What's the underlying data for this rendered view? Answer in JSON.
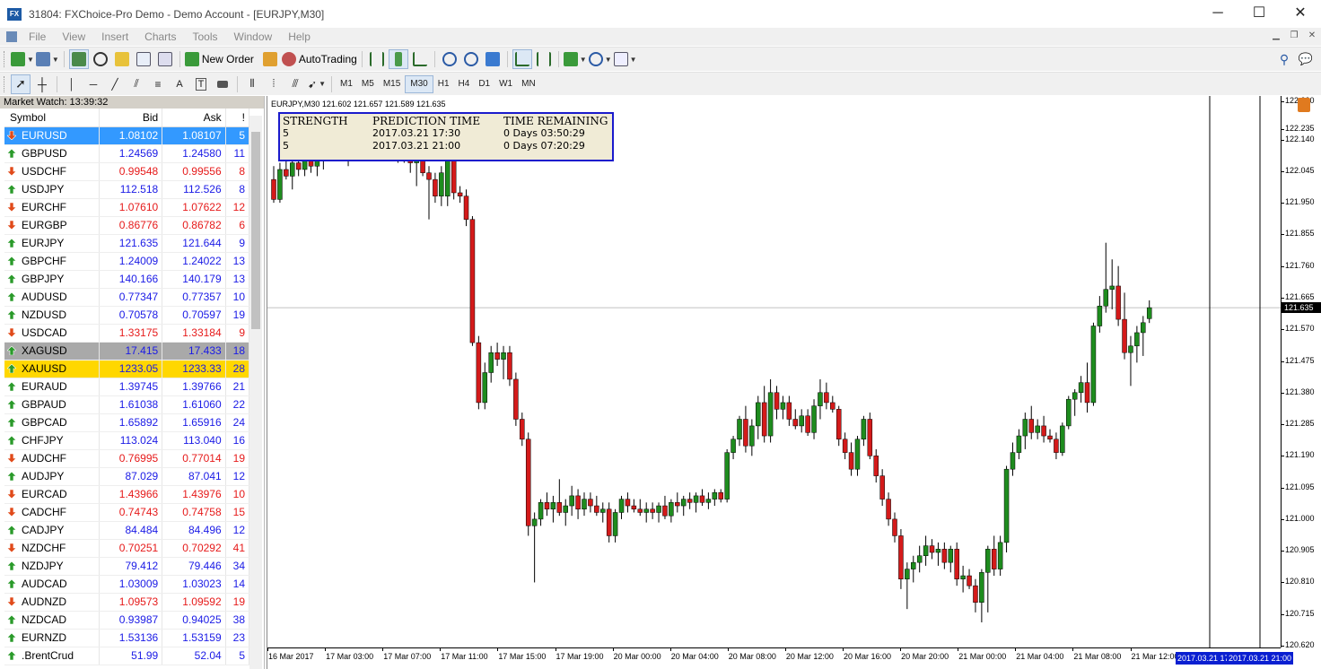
{
  "window": {
    "title": "31804: FXChoice-Pro Demo - Demo Account - [EURJPY,M30]",
    "icon": "fx-app-icon",
    "controls": [
      "─",
      "☐",
      "✕"
    ]
  },
  "menu": [
    "File",
    "View",
    "Insert",
    "Charts",
    "Tools",
    "Window",
    "Help"
  ],
  "toolbar": {
    "new_order": "New Order",
    "auto_trading": "AutoTrading"
  },
  "timeframes": [
    "M1",
    "M5",
    "M15",
    "M30",
    "H1",
    "H4",
    "D1",
    "W1",
    "MN"
  ],
  "active_timeframe": "M30",
  "market_watch": {
    "title": "Market Watch: 13:39:32",
    "columns": [
      "Symbol",
      "Bid",
      "Ask",
      "!"
    ],
    "rows": [
      {
        "symbol": "EURUSD",
        "bid": "1.08102",
        "ask": "1.08107",
        "spread": "5",
        "dir": "down",
        "color": "blue",
        "highlight": "selected"
      },
      {
        "symbol": "GBPUSD",
        "bid": "1.24569",
        "ask": "1.24580",
        "spread": "11",
        "dir": "up",
        "color": "blue"
      },
      {
        "symbol": "USDCHF",
        "bid": "0.99548",
        "ask": "0.99556",
        "spread": "8",
        "dir": "down",
        "color": "red"
      },
      {
        "symbol": "USDJPY",
        "bid": "112.518",
        "ask": "112.526",
        "spread": "8",
        "dir": "up",
        "color": "blue"
      },
      {
        "symbol": "EURCHF",
        "bid": "1.07610",
        "ask": "1.07622",
        "spread": "12",
        "dir": "down",
        "color": "red"
      },
      {
        "symbol": "EURGBP",
        "bid": "0.86776",
        "ask": "0.86782",
        "spread": "6",
        "dir": "down",
        "color": "red"
      },
      {
        "symbol": "EURJPY",
        "bid": "121.635",
        "ask": "121.644",
        "spread": "9",
        "dir": "up",
        "color": "blue"
      },
      {
        "symbol": "GBPCHF",
        "bid": "1.24009",
        "ask": "1.24022",
        "spread": "13",
        "dir": "up",
        "color": "blue"
      },
      {
        "symbol": "GBPJPY",
        "bid": "140.166",
        "ask": "140.179",
        "spread": "13",
        "dir": "up",
        "color": "blue"
      },
      {
        "symbol": "AUDUSD",
        "bid": "0.77347",
        "ask": "0.77357",
        "spread": "10",
        "dir": "up",
        "color": "blue"
      },
      {
        "symbol": "NZDUSD",
        "bid": "0.70578",
        "ask": "0.70597",
        "spread": "19",
        "dir": "up",
        "color": "blue"
      },
      {
        "symbol": "USDCAD",
        "bid": "1.33175",
        "ask": "1.33184",
        "spread": "9",
        "dir": "down",
        "color": "red"
      },
      {
        "symbol": "XAGUSD",
        "bid": "17.415",
        "ask": "17.433",
        "spread": "18",
        "dir": "up",
        "color": "blue",
        "highlight": "gray"
      },
      {
        "symbol": "XAUUSD",
        "bid": "1233.05",
        "ask": "1233.33",
        "spread": "28",
        "dir": "up",
        "color": "blue",
        "highlight": "gold"
      },
      {
        "symbol": "EURAUD",
        "bid": "1.39745",
        "ask": "1.39766",
        "spread": "21",
        "dir": "up",
        "color": "blue"
      },
      {
        "symbol": "GBPAUD",
        "bid": "1.61038",
        "ask": "1.61060",
        "spread": "22",
        "dir": "up",
        "color": "blue"
      },
      {
        "symbol": "GBPCAD",
        "bid": "1.65892",
        "ask": "1.65916",
        "spread": "24",
        "dir": "up",
        "color": "blue"
      },
      {
        "symbol": "CHFJPY",
        "bid": "113.024",
        "ask": "113.040",
        "spread": "16",
        "dir": "up",
        "color": "blue"
      },
      {
        "symbol": "AUDCHF",
        "bid": "0.76995",
        "ask": "0.77014",
        "spread": "19",
        "dir": "down",
        "color": "red"
      },
      {
        "symbol": "AUDJPY",
        "bid": "87.029",
        "ask": "87.041",
        "spread": "12",
        "dir": "up",
        "color": "blue"
      },
      {
        "symbol": "EURCAD",
        "bid": "1.43966",
        "ask": "1.43976",
        "spread": "10",
        "dir": "down",
        "color": "red"
      },
      {
        "symbol": "CADCHF",
        "bid": "0.74743",
        "ask": "0.74758",
        "spread": "15",
        "dir": "down",
        "color": "red"
      },
      {
        "symbol": "CADJPY",
        "bid": "84.484",
        "ask": "84.496",
        "spread": "12",
        "dir": "up",
        "color": "blue"
      },
      {
        "symbol": "NZDCHF",
        "bid": "0.70251",
        "ask": "0.70292",
        "spread": "41",
        "dir": "down",
        "color": "red"
      },
      {
        "symbol": "NZDJPY",
        "bid": "79.412",
        "ask": "79.446",
        "spread": "34",
        "dir": "up",
        "color": "blue"
      },
      {
        "symbol": "AUDCAD",
        "bid": "1.03009",
        "ask": "1.03023",
        "spread": "14",
        "dir": "up",
        "color": "blue"
      },
      {
        "symbol": "AUDNZD",
        "bid": "1.09573",
        "ask": "1.09592",
        "spread": "19",
        "dir": "down",
        "color": "red"
      },
      {
        "symbol": "NZDCAD",
        "bid": "0.93987",
        "ask": "0.94025",
        "spread": "38",
        "dir": "up",
        "color": "blue"
      },
      {
        "symbol": "EURNZD",
        "bid": "1.53136",
        "ask": "1.53159",
        "spread": "23",
        "dir": "up",
        "color": "blue"
      },
      {
        "symbol": ".BrentCrud",
        "bid": "51.99",
        "ask": "52.04",
        "spread": "5",
        "dir": "up",
        "color": "blue"
      }
    ]
  },
  "chart": {
    "header": "EURJPY,M30  121.602 121.657 121.589 121.635",
    "current_price": "121.635",
    "prediction_table": {
      "headers": [
        "STRENGTH",
        "PREDICTION TIME",
        "TIME REMAINING"
      ],
      "rows": [
        [
          "5",
          "2017.03.21 17:30",
          "0 Days 03:50:29"
        ],
        [
          "5",
          "2017.03.21 21:00",
          "0 Days 07:20:29"
        ]
      ]
    },
    "price_labels": [
      "122.230",
      "122.235",
      "122.140",
      "122.045",
      "121.950",
      "121.855",
      "121.760",
      "121.665",
      "121.570",
      "121.475",
      "121.380",
      "121.285",
      "121.190",
      "121.095",
      "121.000",
      "120.905",
      "120.810",
      "120.715",
      "120.620"
    ],
    "time_labels": [
      "16 Mar 2017",
      "17 Mar 03:00",
      "17 Mar 07:00",
      "17 Mar 11:00",
      "17 Mar 15:00",
      "17 Mar 19:00",
      "20 Mar 00:00",
      "20 Mar 04:00",
      "20 Mar 08:00",
      "20 Mar 12:00",
      "20 Mar 16:00",
      "20 Mar 20:00",
      "21 Mar 00:00",
      "21 Mar 04:00",
      "21 Mar 08:00",
      "21 Mar 12:00"
    ],
    "time_highlights": [
      "2017.03.21 17:30",
      "2017.03.21 21:00"
    ]
  },
  "chart_data": {
    "type": "candlestick",
    "symbol": "EURJPY",
    "timeframe": "M30",
    "ylim": [
      120.62,
      122.26
    ],
    "bull_color": "#1e8c1e",
    "bear_color": "#d41a1a",
    "candles": [
      [
        122.02,
        122.06,
        121.95,
        121.96
      ],
      [
        121.96,
        122.07,
        121.95,
        122.05
      ],
      [
        122.05,
        122.1,
        122.02,
        122.03
      ],
      [
        122.03,
        122.09,
        121.99,
        122.07
      ],
      [
        122.07,
        122.12,
        122.03,
        122.05
      ],
      [
        122.05,
        122.11,
        122.03,
        122.08
      ],
      [
        122.08,
        122.13,
        122.04,
        122.06
      ],
      [
        122.06,
        122.12,
        122.03,
        122.1
      ],
      [
        122.1,
        122.16,
        122.05,
        122.12
      ],
      [
        122.12,
        122.18,
        122.08,
        122.15
      ],
      [
        122.15,
        122.22,
        122.11,
        122.13
      ],
      [
        122.13,
        122.16,
        122.09,
        122.14
      ],
      [
        122.14,
        122.17,
        122.06,
        122.12
      ],
      [
        122.12,
        122.2,
        122.08,
        122.16
      ],
      [
        122.16,
        122.22,
        122.1,
        122.14
      ],
      [
        122.14,
        122.2,
        122.11,
        122.18
      ],
      [
        122.18,
        122.22,
        122.13,
        122.15
      ],
      [
        122.15,
        122.18,
        122.09,
        122.1
      ],
      [
        122.1,
        122.15,
        122.08,
        122.13
      ],
      [
        122.13,
        122.16,
        122.09,
        122.14
      ],
      [
        122.14,
        122.16,
        122.07,
        122.11
      ],
      [
        122.11,
        122.15,
        122.07,
        122.13
      ],
      [
        122.13,
        122.16,
        122.04,
        122.07
      ],
      [
        122.07,
        122.13,
        122.0,
        122.13
      ],
      [
        122.13,
        122.18,
        122.03,
        122.04
      ],
      [
        122.04,
        122.06,
        121.9,
        122.02
      ],
      [
        122.02,
        122.04,
        121.95,
        121.97
      ],
      [
        121.97,
        122.06,
        121.94,
        122.04
      ],
      [
        121.97,
        122.12,
        121.94,
        122.08
      ],
      [
        122.08,
        122.12,
        121.96,
        121.98
      ],
      [
        121.98,
        122.0,
        121.95,
        121.97
      ],
      [
        121.97,
        121.99,
        121.88,
        121.9
      ],
      [
        121.9,
        121.91,
        121.52,
        121.53
      ],
      [
        121.53,
        121.55,
        121.33,
        121.35
      ],
      [
        121.35,
        121.47,
        121.33,
        121.44
      ],
      [
        121.44,
        121.52,
        121.41,
        121.5
      ],
      [
        121.5,
        121.53,
        121.46,
        121.48
      ],
      [
        121.48,
        121.52,
        121.42,
        121.5
      ],
      [
        121.5,
        121.52,
        121.4,
        121.42
      ],
      [
        121.42,
        121.44,
        121.28,
        121.3
      ],
      [
        121.3,
        121.32,
        121.22,
        121.24
      ],
      [
        121.24,
        121.26,
        120.95,
        120.98
      ],
      [
        120.98,
        121.02,
        120.81,
        121.0
      ],
      [
        121.0,
        121.06,
        120.98,
        121.05
      ],
      [
        121.05,
        121.08,
        121.01,
        121.03
      ],
      [
        121.03,
        121.07,
        120.99,
        121.05
      ],
      [
        121.05,
        121.12,
        121.01,
        121.02
      ],
      [
        121.02,
        121.06,
        120.98,
        121.04
      ],
      [
        121.04,
        121.1,
        121.01,
        121.07
      ],
      [
        121.07,
        121.09,
        121.0,
        121.03
      ],
      [
        121.03,
        121.08,
        121.01,
        121.06
      ],
      [
        121.06,
        121.08,
        121.02,
        121.04
      ],
      [
        121.04,
        121.07,
        121.01,
        121.02
      ],
      [
        121.02,
        121.05,
        120.99,
        121.03
      ],
      [
        121.03,
        121.05,
        120.93,
        120.95
      ],
      [
        120.95,
        121.03,
        120.93,
        121.02
      ],
      [
        121.02,
        121.07,
        121.0,
        121.06
      ],
      [
        121.06,
        121.08,
        121.02,
        121.04
      ],
      [
        121.04,
        121.06,
        121.02,
        121.03
      ],
      [
        121.03,
        121.06,
        121.01,
        121.02
      ],
      [
        121.02,
        121.05,
        120.99,
        121.03
      ],
      [
        121.03,
        121.05,
        121.0,
        121.02
      ],
      [
        121.02,
        121.05,
        120.99,
        121.04
      ],
      [
        121.04,
        121.07,
        121.0,
        121.01
      ],
      [
        121.01,
        121.06,
        120.99,
        121.05
      ],
      [
        121.05,
        121.08,
        121.02,
        121.04
      ],
      [
        121.04,
        121.07,
        121.01,
        121.06
      ],
      [
        121.06,
        121.08,
        121.03,
        121.05
      ],
      [
        121.05,
        121.08,
        121.02,
        121.07
      ],
      [
        121.07,
        121.09,
        121.04,
        121.05
      ],
      [
        121.05,
        121.08,
        121.03,
        121.06
      ],
      [
        121.06,
        121.09,
        121.04,
        121.08
      ],
      [
        121.08,
        121.09,
        121.05,
        121.06
      ],
      [
        121.06,
        121.21,
        121.05,
        121.2
      ],
      [
        121.2,
        121.25,
        121.18,
        121.24
      ],
      [
        121.24,
        121.31,
        121.22,
        121.3
      ],
      [
        121.3,
        121.34,
        121.2,
        121.22
      ],
      [
        121.22,
        121.3,
        121.19,
        121.28
      ],
      [
        121.28,
        121.37,
        121.24,
        121.35
      ],
      [
        121.35,
        121.4,
        121.23,
        121.25
      ],
      [
        121.25,
        121.42,
        121.23,
        121.38
      ],
      [
        121.38,
        121.4,
        121.3,
        121.33
      ],
      [
        121.33,
        121.37,
        121.3,
        121.35
      ],
      [
        121.35,
        121.37,
        121.28,
        121.3
      ],
      [
        121.3,
        121.33,
        121.27,
        121.28
      ],
      [
        121.28,
        121.33,
        121.26,
        121.31
      ],
      [
        121.31,
        121.33,
        121.25,
        121.26
      ],
      [
        121.26,
        121.36,
        121.24,
        121.34
      ],
      [
        121.34,
        121.42,
        121.3,
        121.38
      ],
      [
        121.38,
        121.41,
        121.33,
        121.35
      ],
      [
        121.35,
        121.37,
        121.32,
        121.33
      ],
      [
        121.33,
        121.34,
        121.22,
        121.24
      ],
      [
        121.24,
        121.26,
        121.18,
        121.2
      ],
      [
        121.2,
        121.23,
        121.13,
        121.15
      ],
      [
        121.15,
        121.25,
        121.13,
        121.24
      ],
      [
        121.24,
        121.31,
        121.22,
        121.3
      ],
      [
        121.3,
        121.32,
        121.18,
        121.19
      ],
      [
        121.19,
        121.21,
        121.11,
        121.13
      ],
      [
        121.13,
        121.15,
        121.04,
        121.06
      ],
      [
        121.06,
        121.08,
        120.98,
        121.0
      ],
      [
        121.0,
        121.02,
        120.93,
        120.95
      ],
      [
        120.95,
        120.97,
        120.79,
        120.82
      ],
      [
        120.82,
        120.87,
        120.73,
        120.85
      ],
      [
        120.85,
        120.89,
        120.81,
        120.87
      ],
      [
        120.87,
        120.92,
        120.84,
        120.89
      ],
      [
        120.89,
        120.95,
        120.86,
        120.92
      ],
      [
        120.92,
        120.94,
        120.88,
        120.9
      ],
      [
        120.9,
        120.93,
        120.86,
        120.91
      ],
      [
        120.91,
        120.93,
        120.85,
        120.87
      ],
      [
        120.87,
        120.92,
        120.84,
        120.91
      ],
      [
        120.91,
        120.93,
        120.8,
        120.82
      ],
      [
        120.82,
        120.86,
        120.78,
        120.83
      ],
      [
        120.83,
        120.85,
        120.79,
        120.8
      ],
      [
        120.8,
        120.82,
        120.72,
        120.75
      ],
      [
        120.75,
        120.85,
        120.69,
        120.84
      ],
      [
        120.84,
        120.92,
        120.72,
        120.91
      ],
      [
        120.91,
        120.95,
        120.83,
        120.85
      ],
      [
        120.85,
        120.95,
        120.83,
        120.93
      ],
      [
        120.93,
        121.16,
        120.9,
        121.15
      ],
      [
        121.15,
        121.23,
        121.13,
        121.2
      ],
      [
        121.2,
        121.27,
        121.18,
        121.25
      ],
      [
        121.25,
        121.32,
        121.21,
        121.3
      ],
      [
        121.3,
        121.34,
        121.24,
        121.26
      ],
      [
        121.26,
        121.3,
        121.24,
        121.28
      ],
      [
        121.28,
        121.31,
        121.23,
        121.25
      ],
      [
        121.25,
        121.27,
        121.23,
        121.24
      ],
      [
        121.24,
        121.26,
        121.18,
        121.2
      ],
      [
        121.2,
        121.29,
        121.19,
        121.28
      ],
      [
        121.28,
        121.37,
        121.27,
        121.36
      ],
      [
        121.36,
        121.39,
        121.31,
        121.38
      ],
      [
        121.38,
        121.43,
        121.35,
        121.41
      ],
      [
        121.41,
        121.47,
        121.32,
        121.35
      ],
      [
        121.35,
        121.59,
        121.34,
        121.58
      ],
      [
        121.58,
        121.67,
        121.56,
        121.64
      ],
      [
        121.64,
        121.83,
        121.62,
        121.69
      ],
      [
        121.69,
        121.78,
        121.63,
        121.7
      ],
      [
        121.7,
        121.76,
        121.58,
        121.6
      ],
      [
        121.6,
        121.68,
        121.48,
        121.5
      ],
      [
        121.5,
        121.55,
        121.4,
        121.52
      ],
      [
        121.52,
        121.58,
        121.47,
        121.56
      ],
      [
        121.56,
        121.61,
        121.49,
        121.59
      ],
      [
        121.602,
        121.657,
        121.589,
        121.635
      ]
    ]
  }
}
